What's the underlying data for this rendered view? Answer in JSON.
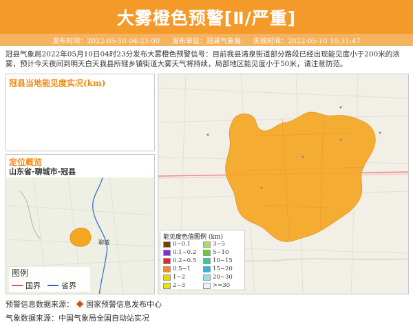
{
  "header": {
    "title": "大雾橙色预警[Ⅱ/严重]",
    "publish_time": "发布时间：2022-05-10 04:23:00",
    "publisher": "发布单位：冠县气象局",
    "expire_time": "失效时间：2022-05-10 10:31:47"
  },
  "description": "冠县气象局2022年05月10日04时23分发布大雾橙色预警信号：目前我县清泉街道部分路段已经出现能见度小于200米的浓雾，预计今天夜间到明天白天我县所辖乡镇街道大雾天气将持续，局部地区能见度小于50米，请注意防范。",
  "visibility_panel": {
    "title": "冠县当地能见度实况(km)"
  },
  "location_panel": {
    "title": "定位概览",
    "subtitle": "山东省-聊城市-冠县",
    "legend_title": "图例",
    "legend_items": [
      "国界",
      "省界"
    ],
    "city_label": "聊城"
  },
  "map_legend": {
    "title": "能见度色值图例 (km)",
    "items": [
      {
        "label": "0~0.1",
        "color": "#7b3f00"
      },
      {
        "label": "3~5",
        "color": "#a6e05a"
      },
      {
        "label": "0.1~0.2",
        "color": "#8a2be2"
      },
      {
        "label": "5~10",
        "color": "#66cc33"
      },
      {
        "label": "0.2~0.5",
        "color": "#e22a2a"
      },
      {
        "label": "10~15",
        "color": "#33cc99"
      },
      {
        "label": "0.5~1",
        "color": "#ff8c1a"
      },
      {
        "label": "15~20",
        "color": "#33b5e5"
      },
      {
        "label": "1~2",
        "color": "#f5d000"
      },
      {
        "label": "20~30",
        "color": "#99ddee"
      },
      {
        "label": "2~3",
        "color": "#e6e600"
      },
      {
        "label": ">=30",
        "color": "#f2f2f2"
      }
    ]
  },
  "footer": {
    "warning_source_label": "预警信息数据来源：",
    "warning_source": "国家预警信息发布中心",
    "weather_source": "气象数据来源：中国气象局全国自动站实况"
  },
  "colors": {
    "accent": "#f39a2b",
    "warning_area": "#f5a623",
    "title_orange": "#f08a12"
  }
}
